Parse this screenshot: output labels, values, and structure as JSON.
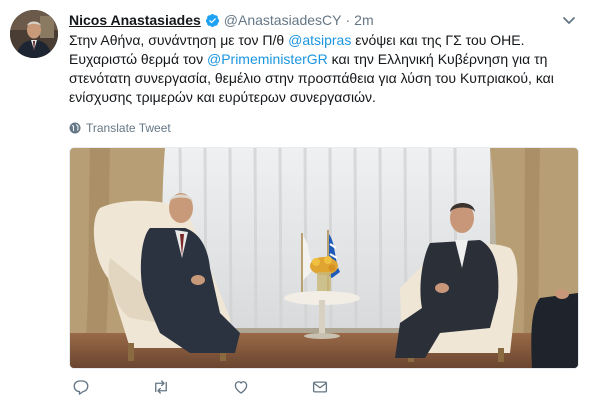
{
  "tweet": {
    "author_name": "Nicos Anastasiades",
    "handle": "@AnastasiadesCY",
    "separator": "·",
    "time": "2m",
    "line1_a": "Στην Αθήνα, συνάντηση με τον Π/θ ",
    "line1_mention": "@atsipras",
    "line1_b": " ενόψει και της ΓΣ του ΟΗΕ.",
    "line2_a": "Ευχαριστώ θερμά τον ",
    "line2_mention": "@PrimeministerGR",
    "line2_b": " και την Ελληνική Κυβέρνηση για τη στενότατη συνεργασία, θεμέλιο στην προσπάθεια για λύση του Κυπριακού, και ενίσχυσης τριμερών και ευρύτερων συνεργασιών.",
    "translate_label": "Translate Tweet"
  },
  "icons": {
    "verified": "verified-badge-icon",
    "caret": "chevron-down-icon",
    "globe": "globe-icon",
    "reply": "reply-icon",
    "retweet": "retweet-icon",
    "like": "heart-icon",
    "dm": "envelope-icon"
  },
  "colors": {
    "link": "#1b95e0",
    "secondary": "#657786",
    "verified": "#1da1f2"
  }
}
